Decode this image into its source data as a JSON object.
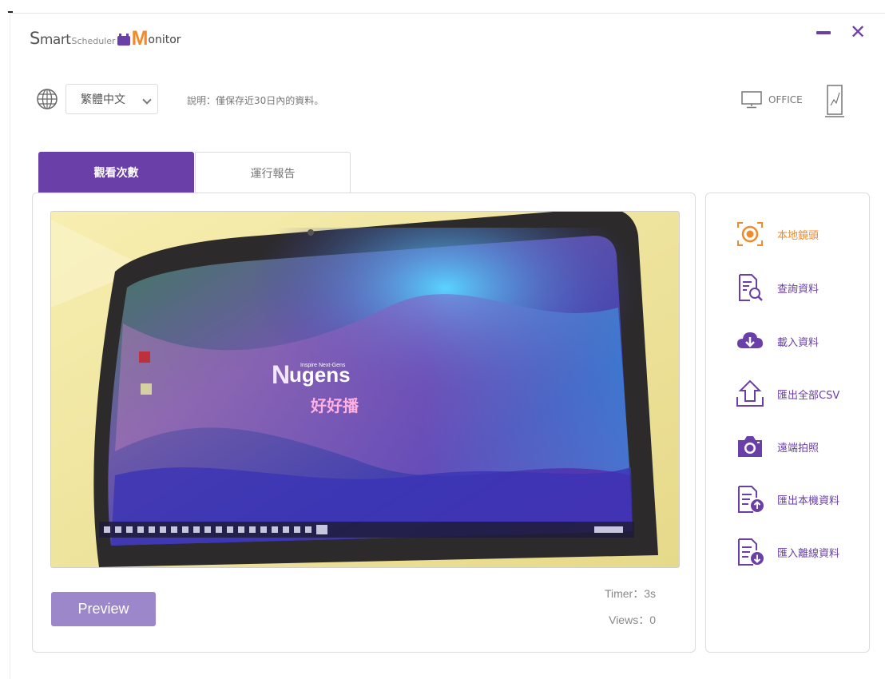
{
  "app": {
    "logo_smart": "mart",
    "logo_s": "S",
    "logo_scheduler": "Scheduler",
    "logo_m": "M",
    "logo_onitor": "onitor"
  },
  "window": {
    "minimize_icon": "minus-icon",
    "close_icon": "x-icon"
  },
  "toolbar": {
    "language_icon": "globe-icon",
    "language_value": "繁體中文",
    "note": "說明：僅保存近30日內的資料。",
    "office_label": "OFFICE",
    "office_icon": "monitor-icon",
    "kiosk_icon": "kiosk-display-icon"
  },
  "tabs": [
    {
      "label": "觀看次數",
      "active": true
    },
    {
      "label": "運行報告",
      "active": false
    }
  ],
  "preview": {
    "button_label": "Preview",
    "timer": "Timer：3s",
    "views": "Views：0",
    "screen_brand": "ugens",
    "screen_brand_n": "N",
    "screen_tagline": "Inspire Next-Gens",
    "screen_subbrand": "好好播"
  },
  "side_menu": [
    {
      "label": "本地鏡頭",
      "icon": "camera-lens-icon",
      "active": true
    },
    {
      "label": "查詢資料",
      "icon": "document-search-icon",
      "active": false
    },
    {
      "label": "載入資料",
      "icon": "cloud-download-icon",
      "active": false
    },
    {
      "label": "匯出全部CSV",
      "icon": "upload-tray-icon",
      "active": false
    },
    {
      "label": "遠端拍照",
      "icon": "photo-camera-icon",
      "active": false
    },
    {
      "label": "匯出本機資料",
      "icon": "document-export-icon",
      "active": false
    },
    {
      "label": "匯入離線資料",
      "icon": "document-import-icon",
      "active": false
    }
  ],
  "colors": {
    "accent": "#6a3fa8",
    "accent_light": "#9b87c9",
    "active_orange": "#f08a2c"
  }
}
